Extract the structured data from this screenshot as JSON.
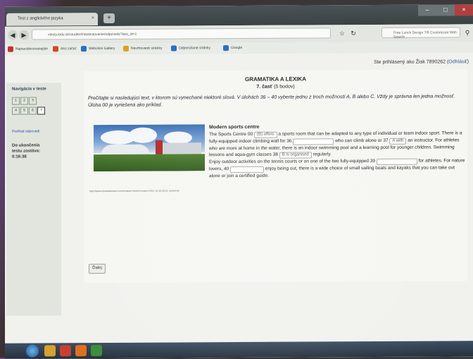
{
  "browser": {
    "tab_title": "Test z anglického jazyka",
    "tab_close": "×",
    "new_tab": "+",
    "url": "vtesty.iedu.sk/student/nastestovanie/odpovedz?test_id=1",
    "search_placeholder": "Free Lunch Design 7/8 Customized Web Search",
    "bookmarks": [
      {
        "label": "Najnavštevovanejšie",
        "color": "#c43030"
      },
      {
        "label": "Ako začať",
        "color": "#d04a2a"
      },
      {
        "label": "Webslice Gallery",
        "color": "#2a6fc4"
      },
      {
        "label": "Navrhované stránky",
        "color": "#e0a020"
      },
      {
        "label": "Odporúčané stránky",
        "color": "#2a6fc4"
      },
      {
        "label": "Google",
        "color": "#2a6fc4"
      }
    ]
  },
  "header": {
    "login_text": "Ste prihlásený ako Žiak 7890262 (",
    "logout_label": "Odhlásiť",
    "login_close": ")"
  },
  "sidebar": {
    "title": "Navigácia v teste",
    "question_buttons": [
      "1",
      "2",
      "3",
      "4",
      "5",
      "6",
      "7"
    ],
    "finish_link": "Prehľad odpovedí",
    "timer_label": "Do ukončenia testu zostáva:",
    "timer_value": "0:16:38"
  },
  "main": {
    "heading": "GRAMATIKA A LEXIKA",
    "part_label": "7. časť",
    "part_points": "(5 bodov)",
    "instructions": "Prečítajte si nasledujúci text, v ktorom sú vynechané niektoré slová. V úlohách 36 – 40 vyberte jednu z troch možností A, B alebo C. Vždy je správna len jedna možnosť. Úloha 00 je vyriešená ako príklad.",
    "article_title": "Modern sports centre",
    "para1_a": "The Sports Centre 00",
    "sel_00": "(B) offers",
    "para1_b": "a sports room that can be adapted to any type of individual or team indoor sport. There is a fully-equipped indoor climbing wall for 36",
    "para1_c": "who can climb alone or 37",
    "sel_37": "A with",
    "para1_d": "an instructor. For athletes who are more at home in the water, there is an indoor swimming pool and a learning pool for younger children. Swimming lessons and aqua-gym classes 38",
    "sel_38": "B is organised",
    "para1_e": "regularly.",
    "para2_a": "Enjoy outdoor activities on the tennis courts or on one of the two fully-equipped 39",
    "para2_b": "for athletes. For nature lovers, 40",
    "para2_c": "enjoy being out, there is a wide choice of small sailing boats and kayaks that you can take out alone or join a certified guide.",
    "source": "http://www.myswitzerland.com/en/sport-centre-locarno.html, 15.10.2013, upravené",
    "next_button": "Ďalej"
  }
}
